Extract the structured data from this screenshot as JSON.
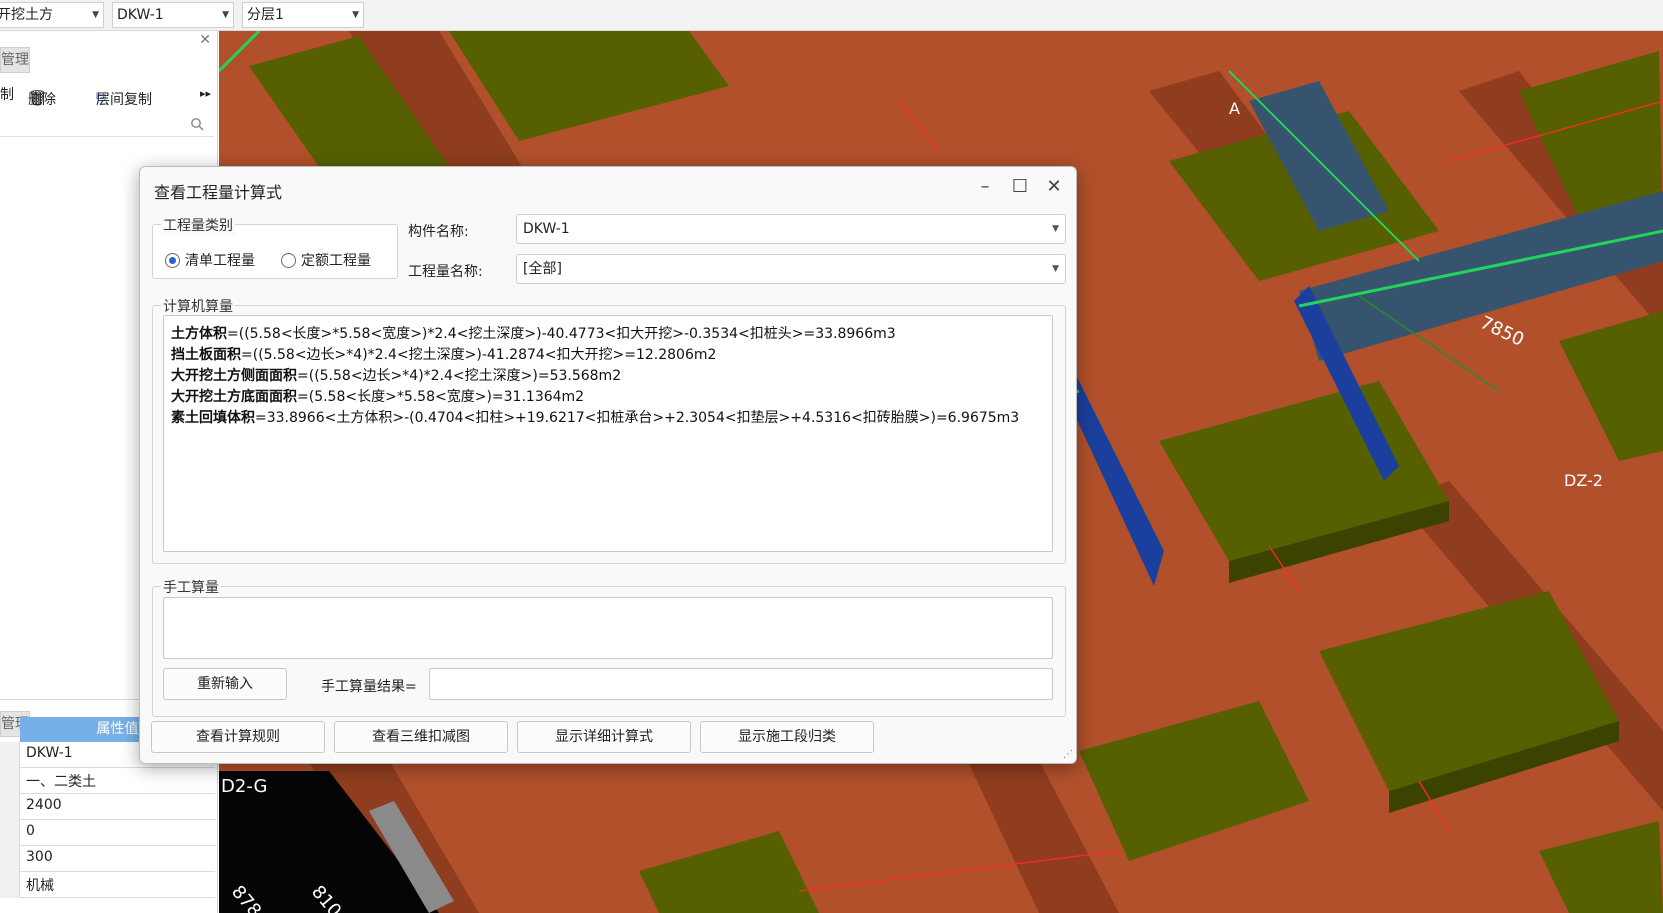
{
  "toolbar": {
    "combo1": "开挖土方",
    "combo2": "DKW-1",
    "combo3": "分层1"
  },
  "left_panel": {
    "tab_top": "管理",
    "copy_label": "制",
    "delete_label": "删除",
    "floor_copy_label": "层间复制",
    "more_label": "▸▸",
    "tab_bottom": "管理",
    "prop_header": "属性值",
    "prop_values": [
      "DKW-1",
      "一、二类土",
      "2400",
      "0",
      "300",
      "机械"
    ]
  },
  "viewport": {
    "label_d2g": "D2-G",
    "label_878": "878",
    "label_810": "810",
    "label_7850": "7850",
    "label_dz": "DZ-2",
    "label_a": "A"
  },
  "dialog": {
    "title": "查看工程量计算式",
    "group_type": "工程量类别",
    "radio_bill": "清单工程量",
    "radio_quota": "定额工程量",
    "component_label": "构件名称:",
    "component_value": "DKW-1",
    "quantity_label": "工程量名称:",
    "quantity_value": "[全部]",
    "computer_group": "计算机算量",
    "formulas": [
      {
        "name": "土方体积",
        "expr": "=((5.58<长度>*5.58<宽度>)*2.4<挖土深度>)-40.4773<扣大开挖>-0.3534<扣桩头>=33.8966m3"
      },
      {
        "name": "挡土板面积",
        "expr": "=((5.58<边长>*4)*2.4<挖土深度>)-41.2874<扣大开挖>=12.2806m2"
      },
      {
        "name": "大开挖土方侧面面积",
        "expr": "=((5.58<边长>*4)*2.4<挖土深度>)=53.568m2"
      },
      {
        "name": "大开挖土方底面面积",
        "expr": "=(5.58<长度>*5.58<宽度>)=31.1364m2"
      },
      {
        "name": "素土回填体积",
        "expr": "=33.8966<土方体积>-(0.4704<扣柱>+19.6217<扣桩承台>+2.3054<扣垫层>+4.5316<扣砖胎膜>)=6.9675m3"
      }
    ],
    "manual_group": "手工算量",
    "reenter_button": "重新输入",
    "manual_result_label": "手工算量结果=",
    "manual_result_value": "",
    "btn_rules": "查看计算规则",
    "btn_3d": "查看三维扣减图",
    "btn_detail": "显示详细计算式",
    "btn_segment": "显示施工段归类"
  },
  "colors": {
    "soil": "#b1502b",
    "pad": "#566000",
    "wall_blue": "#1a3f9c",
    "selection_green": "#22d45a",
    "header_blue": "#77b0e8"
  }
}
